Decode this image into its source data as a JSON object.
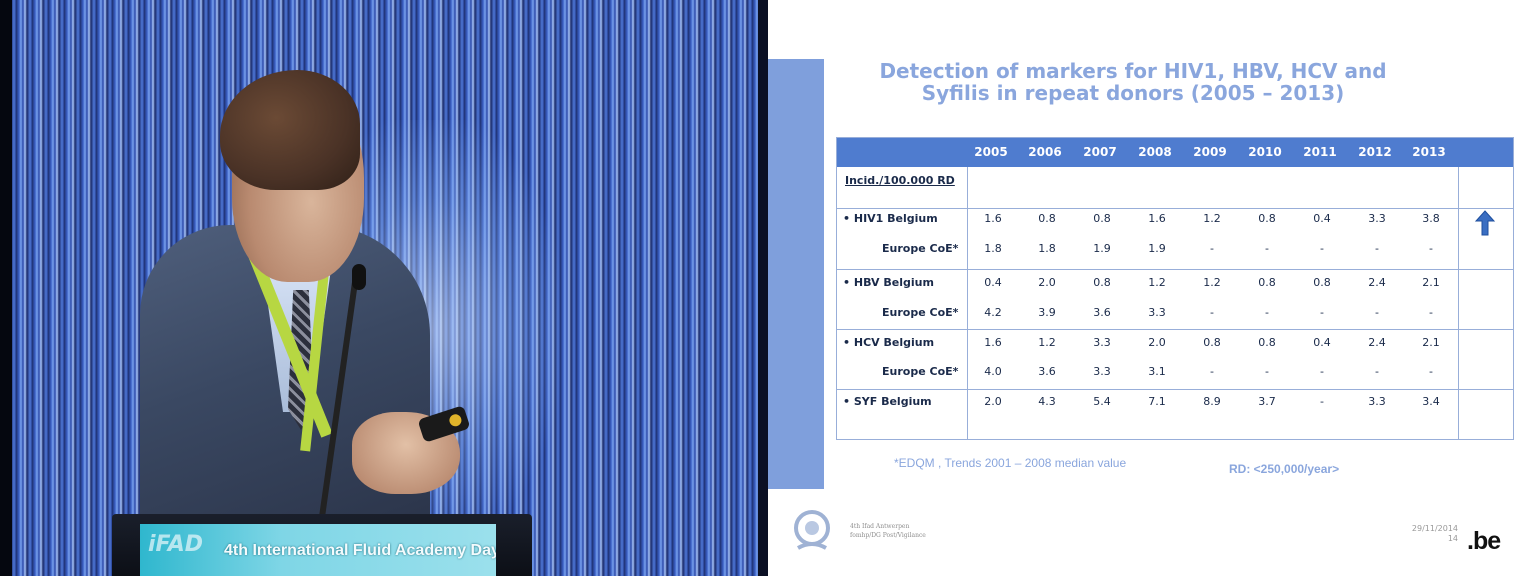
{
  "video": {
    "podium_logo": "iFAD",
    "podium_text": "4th International Fluid Academy Days"
  },
  "slide": {
    "title_line1": "Detection of markers for HIV1, HBV, HCV and",
    "title_line2": "Syfilis in repeat donors (2005 – 2013)",
    "table": {
      "years": [
        "2005",
        "2006",
        "2007",
        "2008",
        "2009",
        "2010",
        "2011",
        "2012",
        "2013"
      ],
      "unit_label": "Incid./100.000 RD",
      "rows": [
        {
          "label": "• HIV1 Belgium",
          "values": [
            "1.6",
            "0.8",
            "0.8",
            "1.6",
            "1.2",
            "0.8",
            "0.4",
            "3.3",
            "3.8"
          ]
        },
        {
          "label": "Europe CoE*",
          "values": [
            "1.8",
            "1.8",
            "1.9",
            "1.9",
            "-",
            "-",
            "-",
            "-",
            "-"
          ]
        },
        {
          "label": "• HBV Belgium",
          "values": [
            "0.4",
            "2.0",
            "0.8",
            "1.2",
            "1.2",
            "0.8",
            "0.8",
            "2.4",
            "2.1"
          ]
        },
        {
          "label": "Europe CoE*",
          "values": [
            "4.2",
            "3.9",
            "3.6",
            "3.3",
            "-",
            "-",
            "-",
            "-",
            "-"
          ]
        },
        {
          "label": "• HCV  Belgium",
          "values": [
            "1.6",
            "1.2",
            "3.3",
            "2.0",
            "0.8",
            "0.8",
            "0.4",
            "2.4",
            "2.1"
          ]
        },
        {
          "label": "Europe CoE*",
          "values": [
            "4.0",
            "3.6",
            "3.3",
            "3.1",
            "-",
            "-",
            "-",
            "-",
            "-"
          ]
        },
        {
          "label": "• SYF  Belgium",
          "values": [
            "2.0",
            "4.3",
            "5.4",
            "7.1",
            "8.9",
            "3.7",
            "-",
            "3.3",
            "3.4"
          ]
        }
      ],
      "trend_icon": "up-arrow-icon"
    },
    "footnote": "*EDQM , Trends 2001 – 2008 median value",
    "rd_note": "RD: <250,000/year>",
    "footer": {
      "org_line1": "4th Ifad Antwerpen",
      "org_line2": "fomhp/DG Post/Vigilance",
      "date": "29/11/2014",
      "page": "14",
      "brand": ".be"
    }
  },
  "colors": {
    "title": "#8aa6dd",
    "table_header": "#4f7ccf",
    "side_bar": "#7f9fdc",
    "arrow": "#3a6ec2"
  }
}
